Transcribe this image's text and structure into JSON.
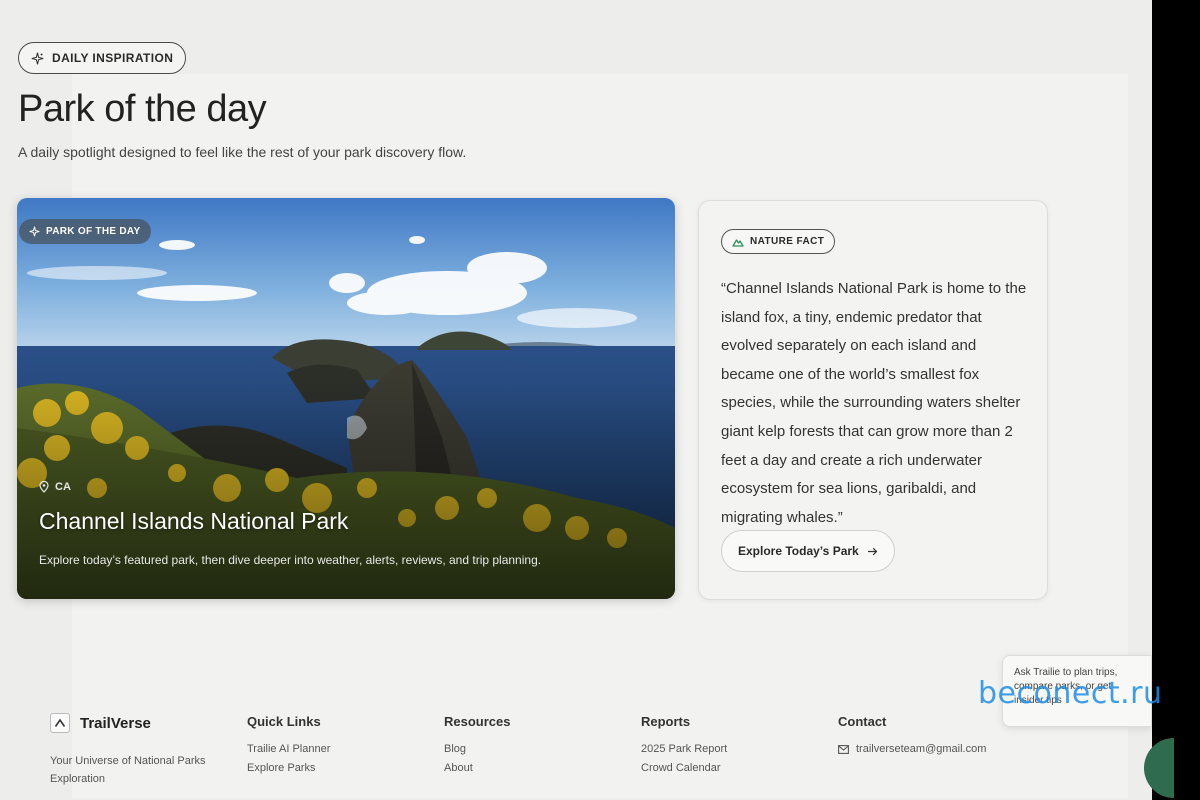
{
  "header": {
    "badge": "Daily Inspiration",
    "title": "Park of the day",
    "subtitle": "A daily spotlight designed to feel like the rest of your park discovery flow."
  },
  "hero": {
    "badge": "Park of the day",
    "location": "CA",
    "title": "Channel Islands National Park",
    "description": "Explore today’s featured park, then dive deeper into weather, alerts, reviews, and trip planning."
  },
  "fact": {
    "badge": "Nature Fact",
    "text": "“Channel Islands National Park is home to the island fox, a tiny, endemic predator that evolved separately on each island and became one of the world’s smallest fox species, while the surrounding waters shelter giant kelp forests that can grow more than 2 feet a day and create a rich underwater ecosystem for sea lions, garibaldi, and migrating whales.”",
    "button_label": "Explore Today’s Park"
  },
  "footer": {
    "brand_name": "TrailVerse",
    "tagline": "Your Universe of National Parks Exploration",
    "columns": [
      {
        "title": "Quick Links",
        "links": [
          "Trailie AI Planner",
          "Explore Parks"
        ]
      },
      {
        "title": "Resources",
        "links": [
          "Blog",
          "About"
        ]
      },
      {
        "title": "Reports",
        "links": [
          "2025 Park Report",
          "Crowd Calendar"
        ]
      }
    ],
    "contact_title": "Contact",
    "contact_email": "trailverseteam@gmail.com"
  },
  "chat": {
    "tooltip": "Ask Trailie to plan trips, compare parks, or get insider tips"
  },
  "watermark": "beconect.ru",
  "colors": {
    "page_bg": "#ededeb",
    "accent_green": "#2f8f5b",
    "chat_button": "#2f6b4f",
    "watermark": "#1e8ee8"
  },
  "icons": {
    "daily_badge": "sparkle-icon",
    "hero_badge": "sparkle-icon",
    "location": "map-pin-icon",
    "fact_badge": "mountain-icon",
    "button_arrow": "arrow-right-icon",
    "contact": "mail-icon",
    "brand": "mountain-logo-icon"
  }
}
